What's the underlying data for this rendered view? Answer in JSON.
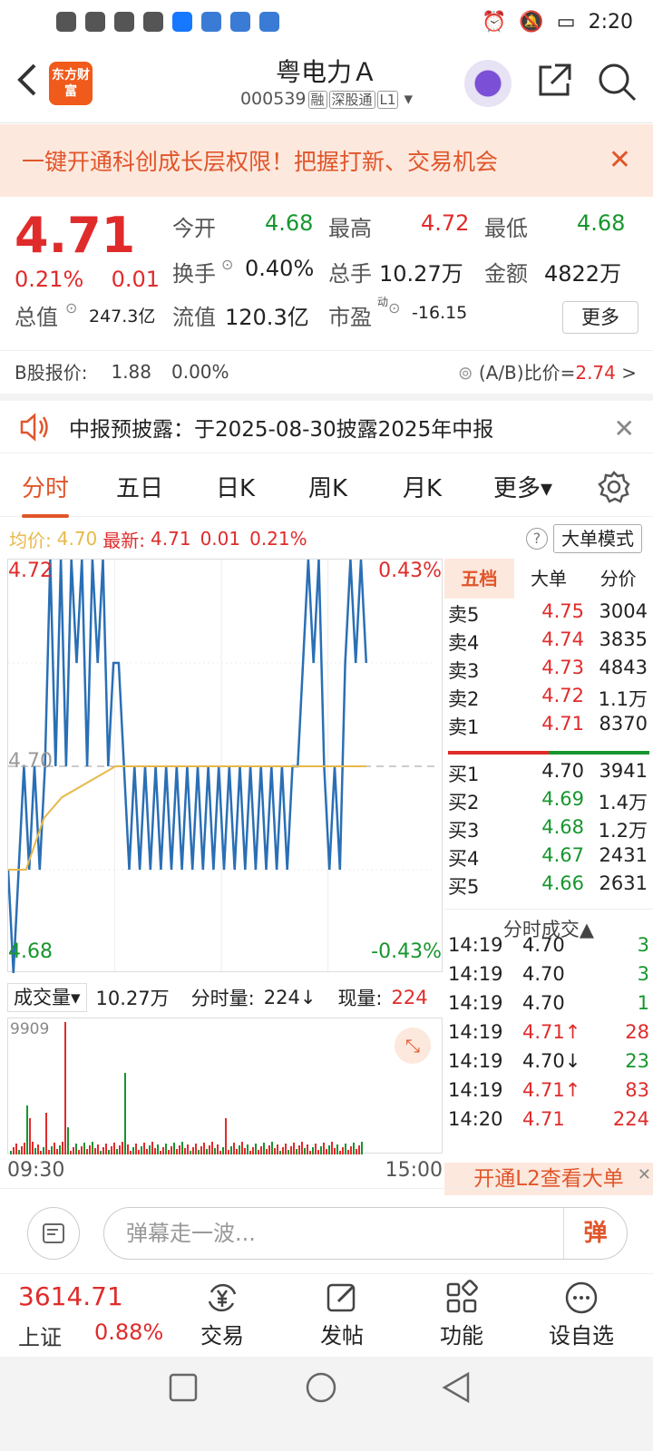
{
  "status_bar": {
    "left_icons": [
      "HD",
      "5G",
      "signal",
      "wifi",
      "wechat",
      "alipay",
      "browser",
      "cloud",
      "browser2"
    ],
    "time": "2:20"
  },
  "header": {
    "back_label": "<",
    "logo_text": "东方财富",
    "title": "粤电力Ａ",
    "code": "000539",
    "tags": [
      "融",
      "深股通",
      "L1"
    ]
  },
  "banner": {
    "text": "一键开通科创成长层权限！把握打新、交易机会",
    "close": "✕"
  },
  "quote": {
    "price": "4.71",
    "change_pct": "0.21%",
    "change": "0.01",
    "open_label": "今开",
    "open": "4.68",
    "high_label": "最高",
    "high": "4.72",
    "low_label": "最低",
    "low": "4.68",
    "turnover_label": "换手",
    "turnover": "0.40%",
    "volume_label": "总手",
    "volume": "10.27万",
    "amount_label": "金额",
    "amount": "4822万",
    "mcap_label": "总值",
    "mcap": "247.3亿",
    "float_label": "流值",
    "float": "120.3亿",
    "pe_label": "市盈",
    "pe_sup": "动",
    "pe": "-16.15",
    "more": "更多"
  },
  "bshare": {
    "label": "B股报价:",
    "price": "1.88",
    "pct": "0.00%",
    "ratio_label": "(A/B)比价=",
    "ratio": "2.74",
    "arrow": ">"
  },
  "notice": {
    "text": "中报预披露：于2025-08-30披露2025年中报",
    "close": "✕"
  },
  "tabs": [
    "分时",
    "五日",
    "日K",
    "周K",
    "月K",
    "更多▾"
  ],
  "avg_row": {
    "avg_label": "均价:",
    "avg": "4.70",
    "latest_label": "最新:",
    "latest": "4.71",
    "chg": "0.01",
    "pct": "0.21%",
    "help": "?",
    "mode": "大单模式"
  },
  "chart_data": {
    "type": "line",
    "title": "",
    "y_top": "4.72",
    "y_mid": "4.70",
    "y_bottom": "4.68",
    "pct_top": "0.43%",
    "pct_bottom": "-0.43%",
    "ylim": [
      4.68,
      4.72
    ],
    "x_start": "09:30",
    "x_end": "15:00",
    "series": [
      {
        "values": [
          4.69,
          4.68,
          4.69,
          4.7,
          4.69,
          4.7,
          4.69,
          4.7,
          4.72,
          4.7,
          4.72,
          4.7,
          4.72,
          4.71,
          4.72,
          4.7,
          4.72,
          4.71,
          4.72,
          4.7,
          4.71,
          4.71,
          4.7,
          4.69,
          4.7,
          4.69,
          4.7,
          4.69,
          4.7,
          4.69,
          4.7,
          4.69,
          4.7,
          4.69,
          4.7,
          4.69,
          4.7,
          4.69,
          4.7,
          4.69,
          4.7,
          4.69,
          4.7,
          4.69,
          4.7,
          4.69,
          4.7,
          4.69,
          4.7,
          4.69,
          4.7,
          4.69,
          4.7,
          4.69,
          4.7,
          4.7,
          4.71,
          4.72,
          4.71,
          4.72,
          4.7,
          4.69,
          4.7,
          4.69,
          4.71,
          4.72,
          4.71,
          4.72,
          4.71
        ]
      },
      {
        "values": [
          4.69,
          4.69,
          4.695,
          4.697,
          4.698,
          4.699,
          4.7,
          4.7,
          4.7,
          4.7,
          4.7,
          4.7,
          4.7,
          4.7,
          4.7,
          4.7,
          4.7,
          4.7,
          4.7,
          4.7,
          4.7
        ]
      }
    ]
  },
  "volume": {
    "label": "成交量▾",
    "total": "10.27万",
    "min_label": "分时量:",
    "min_val": "224↓",
    "now_label": "现量:",
    "now_val": "224",
    "max": "9909"
  },
  "right_panel": {
    "tabs": [
      "五档",
      "大单",
      "分价"
    ],
    "asks": [
      {
        "label": "卖5",
        "price": "4.75",
        "vol": "3004"
      },
      {
        "label": "卖4",
        "price": "4.74",
        "vol": "3835"
      },
      {
        "label": "卖3",
        "price": "4.73",
        "vol": "4843"
      },
      {
        "label": "卖2",
        "price": "4.72",
        "vol": "1.1万"
      },
      {
        "label": "卖1",
        "price": "4.71",
        "vol": "8370"
      }
    ],
    "bids": [
      {
        "label": "买1",
        "price": "4.70",
        "vol": "3941"
      },
      {
        "label": "买2",
        "price": "4.69",
        "vol": "1.4万"
      },
      {
        "label": "买3",
        "price": "4.68",
        "vol": "1.2万"
      },
      {
        "label": "买4",
        "price": "4.67",
        "vol": "2431"
      },
      {
        "label": "买5",
        "price": "4.66",
        "vol": "2631"
      }
    ],
    "trades_title": "分时成交▲",
    "trades": [
      {
        "t": "14:19",
        "p": "4.70",
        "v": "3"
      },
      {
        "t": "14:19",
        "p": "4.70",
        "v": "3"
      },
      {
        "t": "14:19",
        "p": "4.70",
        "v": "1"
      },
      {
        "t": "14:19",
        "p": "4.71↑",
        "v": "28"
      },
      {
        "t": "14:19",
        "p": "4.70↓",
        "v": "23"
      },
      {
        "t": "14:19",
        "p": "4.71↑",
        "v": "83"
      },
      {
        "t": "14:20",
        "p": "4.71",
        "v": "224"
      }
    ],
    "l2": "开通L2查看大单",
    "l2_close": "✕"
  },
  "comment": {
    "placeholder": "弹幕走一波...",
    "dan": "弹"
  },
  "bottom": {
    "index": "3614.71",
    "index_name": "上证",
    "index_pct": "0.88%",
    "items": [
      "交易",
      "发帖",
      "功能",
      "设自选"
    ]
  },
  "colors": {
    "up": "#e02b2b",
    "down": "#16962e",
    "accent": "#e0562b",
    "avg": "#e8b84a",
    "line": "#2a6fb5"
  }
}
